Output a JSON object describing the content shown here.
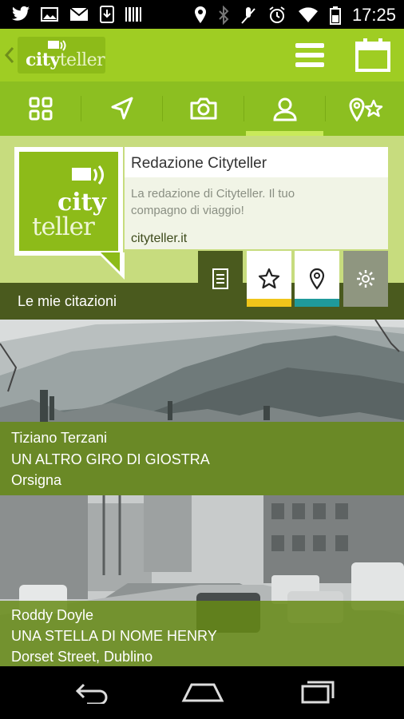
{
  "statusbar": {
    "time": "17:25",
    "left_icons": [
      "twitter-icon",
      "image-icon",
      "mail-icon",
      "download-icon",
      "barcode-icon"
    ],
    "right_icons": [
      "location-icon",
      "bluetooth-icon",
      "mute-icon",
      "alarm-icon",
      "wifi-icon",
      "battery-icon"
    ]
  },
  "appbar": {
    "logo_city": "city",
    "logo_teller": "teller",
    "icons": [
      "back-icon",
      "menu-icon",
      "calendar-icon"
    ]
  },
  "tabs": [
    {
      "icon": "grid-icon",
      "active": false
    },
    {
      "icon": "navigation-arrow-icon",
      "active": false
    },
    {
      "icon": "camera-icon",
      "active": false
    },
    {
      "icon": "user-icon",
      "active": true
    },
    {
      "icon": "pin-star-icon",
      "active": false
    }
  ],
  "profile": {
    "avatar_city": "city",
    "avatar_teller": "teller",
    "name": "Redazione Cityteller",
    "description": "La redazione di Cityteller. Il tuo compagno di viaggio!",
    "website": "cityteller.it",
    "section_label": "Le mie citazioni",
    "actions": [
      {
        "icon": "document-icon",
        "bg": "#4a5a1e",
        "bar": "#4a5a1e"
      },
      {
        "icon": "star-icon",
        "bg": "#ffffff",
        "bar": "#f0c51a"
      },
      {
        "icon": "pin-icon",
        "bg": "#ffffff",
        "bar": "#1f9a9b"
      },
      {
        "icon": "gear-icon",
        "bg": "#8f9680",
        "bar": "#8f9680"
      }
    ]
  },
  "cards": [
    {
      "author": "Tiziano Terzani",
      "title": "UN ALTRO GIRO DI GIOSTRA",
      "place": "Orsigna"
    },
    {
      "author": "Roddy Doyle",
      "title": "UNA STELLA DI NOME HENRY",
      "place": "Dorset Street, Dublino"
    }
  ],
  "navbar": {
    "icons": [
      "back-nav-icon",
      "home-nav-icon",
      "recents-nav-icon"
    ]
  },
  "colors": {
    "brand_green": "#9fcd23",
    "tab_green": "#8cbf21",
    "overlay_green": "#668a14"
  }
}
